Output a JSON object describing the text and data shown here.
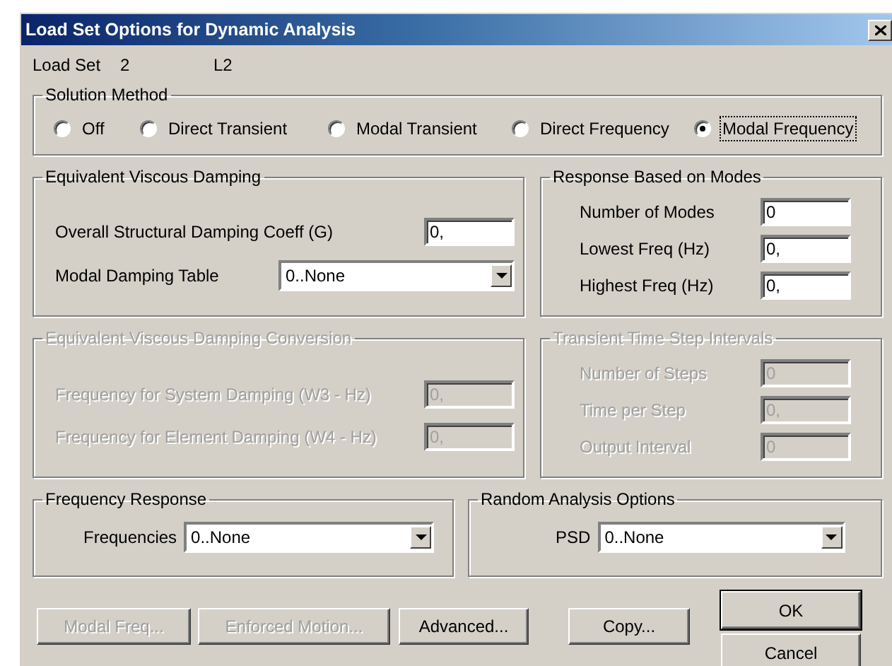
{
  "window": {
    "title": "Load Set Options for Dynamic Analysis"
  },
  "load_set": {
    "label": "Load Set",
    "number": "2",
    "title": "L2"
  },
  "solution_method": {
    "title": "Solution Method",
    "options": [
      {
        "label": "Off",
        "selected": false
      },
      {
        "label": "Direct Transient",
        "selected": false
      },
      {
        "label": "Modal Transient",
        "selected": false
      },
      {
        "label": "Direct Frequency",
        "selected": false
      },
      {
        "label": "Modal Frequency",
        "selected": true
      }
    ]
  },
  "equivalent_viscous_damping": {
    "title": "Equivalent Viscous Damping",
    "disabled": false,
    "fields": [
      {
        "kind": "text",
        "label": "Overall Structural Damping Coeff (G)",
        "value": "0,"
      },
      {
        "kind": "dropdown",
        "label": "Modal Damping Table",
        "value": "0..None"
      }
    ]
  },
  "response_based_on_modes": {
    "title": "Response Based on Modes",
    "disabled": false,
    "fields": [
      {
        "kind": "text",
        "label": "Number of Modes",
        "value": "0"
      },
      {
        "kind": "text",
        "label": "Lowest Freq (Hz)",
        "value": "0,"
      },
      {
        "kind": "text",
        "label": "Highest Freq (Hz)",
        "value": "0,"
      }
    ]
  },
  "equivalent_viscous_damping_conversion": {
    "title": "Equivalent Viscous Damping Conversion",
    "disabled": true,
    "fields": [
      {
        "kind": "text",
        "label": "Frequency for System Damping (W3 - Hz)",
        "value": "0,"
      },
      {
        "kind": "text",
        "label": "Frequency for Element Damping (W4 - Hz)",
        "value": "0,"
      }
    ]
  },
  "transient_time_step_intervals": {
    "title": "Transient Time Step Intervals",
    "disabled": true,
    "fields": [
      {
        "kind": "text",
        "label": "Number of Steps",
        "value": "0"
      },
      {
        "kind": "text",
        "label": "Time per Step",
        "value": "0,"
      },
      {
        "kind": "text",
        "label": "Output Interval",
        "value": "0"
      }
    ]
  },
  "frequency_response": {
    "title": "Frequency Response",
    "disabled": false,
    "fields": [
      {
        "kind": "dropdown",
        "label": "Frequencies",
        "value": "0..None"
      }
    ]
  },
  "random_analysis_options": {
    "title": "Random Analysis Options",
    "disabled": false,
    "fields": [
      {
        "kind": "dropdown",
        "label": "PSD",
        "value": "0..None"
      }
    ]
  },
  "buttons": [
    {
      "label": "Modal Freq...",
      "disabled": true
    },
    {
      "label": "Enforced Motion...",
      "disabled": true
    },
    {
      "label": "Advanced...",
      "disabled": false
    },
    {
      "label": "Copy...",
      "disabled": false
    }
  ],
  "dialog_buttons": [
    {
      "label": "OK",
      "default": true
    },
    {
      "label": "Cancel",
      "default": false
    }
  ]
}
